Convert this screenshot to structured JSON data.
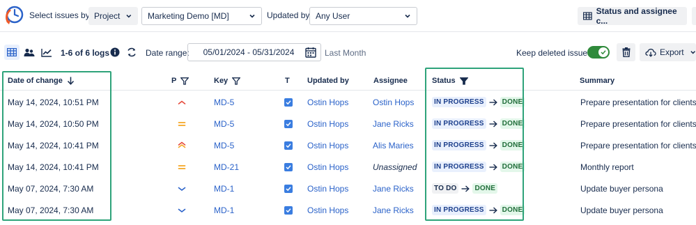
{
  "toolbar": {
    "select_issues_label": "Select issues by:",
    "select_by_value": "Project",
    "project_value": "Marketing Demo [MD]",
    "updated_by_label": "Updated by:",
    "updated_by_value": "Any User",
    "view_button_label": "Status and assignee c..."
  },
  "subbar": {
    "logs_count": "1-6 of 6 logs",
    "date_range_label": "Date range:",
    "date_range_value": "05/01/2024 - 05/31/2024",
    "preset_label": "Last Month",
    "keep_deleted_label": "Keep deleted issues",
    "keep_deleted_on": true,
    "export_label": "Export"
  },
  "table": {
    "headers": {
      "date": "Date of change",
      "priority": "P",
      "key": "Key",
      "type": "T",
      "updated_by": "Updated by",
      "assignee": "Assignee",
      "status": "Status",
      "summary": "Summary"
    },
    "rows": [
      {
        "date": "May 14, 2024, 10:51 PM",
        "priority": "low",
        "key": "MD-5",
        "updated_by": "Ostin Hops",
        "assignee": "Ostin Hops",
        "from": "IN PROGRESS",
        "to": "DONE",
        "summary": "Prepare presentation for clients"
      },
      {
        "date": "May 14, 2024, 10:50 PM",
        "priority": "medium",
        "key": "MD-5",
        "updated_by": "Ostin Hops",
        "assignee": "Jane Ricks",
        "from": "IN PROGRESS",
        "to": "DONE",
        "summary": "Prepare presentation for clients"
      },
      {
        "date": "May 14, 2024, 10:41 PM",
        "priority": "high",
        "key": "MD-5",
        "updated_by": "Ostin Hops",
        "assignee": "Alis Maries",
        "from": "IN PROGRESS",
        "to": "DONE",
        "summary": "Prepare presentation for clients"
      },
      {
        "date": "May 14, 2024, 10:41 PM",
        "priority": "medium",
        "key": "MD-21",
        "updated_by": "Ostin Hops",
        "assignee": "Unassigned",
        "from": "IN PROGRESS",
        "to": "DONE",
        "summary": "Monthly report"
      },
      {
        "date": "May 07, 2024, 7:30 AM",
        "priority": "lowest",
        "key": "MD-1",
        "updated_by": "Ostin Hops",
        "assignee": "Jane Ricks",
        "from": "TO DO",
        "to": "DONE",
        "summary": "Update buyer persona"
      },
      {
        "date": "May 07, 2024, 7:30 AM",
        "priority": "lowest",
        "key": "MD-1",
        "updated_by": "Ostin Hops",
        "assignee": "Jane Ricks",
        "from": "IN PROGRESS",
        "to": "DONE",
        "summary": "Update buyer persona"
      }
    ]
  },
  "colors": {
    "accent": "#2a62c9",
    "highlight": "#2ea37a",
    "toggle_on": "#2f8a3b",
    "priority_orange": "#f5a623",
    "priority_red": "#e5493a",
    "priority_blue": "#2a62c9"
  }
}
